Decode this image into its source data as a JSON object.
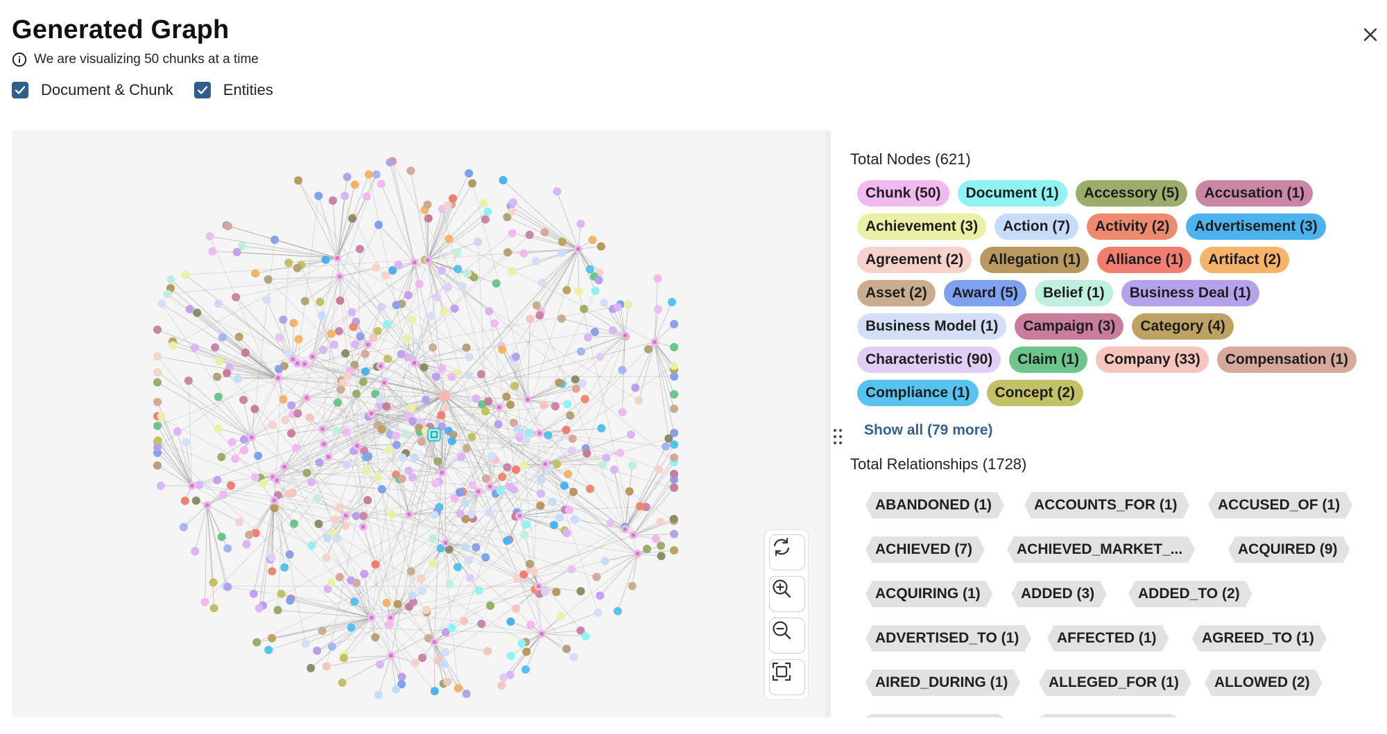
{
  "header": {
    "title": "Generated Graph",
    "info_text": "We are visualizing 50 chunks at a time",
    "checkboxes": [
      {
        "label": "Document & Chunk",
        "checked": true
      },
      {
        "label": "Entities",
        "checked": true
      }
    ]
  },
  "sidebar": {
    "search_placeholder": "",
    "nodes_title": "Total Nodes (621)",
    "node_labels": [
      {
        "label": "Chunk (50)",
        "color": "#f1b9ef"
      },
      {
        "label": "Document (1)",
        "color": "#8ff3f4"
      },
      {
        "label": "Accessory (5)",
        "color": "#9aae6b"
      },
      {
        "label": "Accusation (1)",
        "color": "#c986a6"
      },
      {
        "label": "Achievement (3)",
        "color": "#ebf0a7"
      },
      {
        "label": "Action (7)",
        "color": "#c6dcf8"
      },
      {
        "label": "Activity (2)",
        "color": "#ed8a6f"
      },
      {
        "label": "Advertisement (3)",
        "color": "#4db3ef"
      },
      {
        "label": "Agreement (2)",
        "color": "#f6d2cb"
      },
      {
        "label": "Allegation (1)",
        "color": "#b89a60"
      },
      {
        "label": "Alliance (1)",
        "color": "#f07f72"
      },
      {
        "label": "Artifact (2)",
        "color": "#f5b46a"
      },
      {
        "label": "Asset (2)",
        "color": "#c9ad8e"
      },
      {
        "label": "Award (5)",
        "color": "#7ea1f0"
      },
      {
        "label": "Belief (1)",
        "color": "#bff0dd"
      },
      {
        "label": "Business Deal (1)",
        "color": "#b4a3ec"
      },
      {
        "label": "Business Model (1)",
        "color": "#d3def7"
      },
      {
        "label": "Campaign (3)",
        "color": "#c77d9b"
      },
      {
        "label": "Category (4)",
        "color": "#bea264"
      },
      {
        "label": "Characteristic (90)",
        "color": "#e2cdf7"
      },
      {
        "label": "Claim (1)",
        "color": "#6dc48c"
      },
      {
        "label": "Company (33)",
        "color": "#f6c5bd"
      },
      {
        "label": "Compensation (1)",
        "color": "#d6a99c"
      },
      {
        "label": "Compliance (1)",
        "color": "#55c3ee"
      },
      {
        "label": "Concept (2)",
        "color": "#c2c166"
      }
    ],
    "show_all": "Show all (79 more)",
    "relationships_title": "Total Relationships (1728)",
    "relationship_rows": [
      [
        "ABANDONED (1)",
        "ACCOUNTS_FOR (1)",
        "ACCUSED_OF (1)"
      ],
      [
        "ACHIEVED (7)",
        "ACHIEVED_MARKET_...",
        "ACQUIRED (9)"
      ],
      [
        "ACQUIRING (1)",
        "ADDED (3)",
        "ADDED_TO (2)"
      ],
      [
        "ADVERTISED_TO (1)",
        "AFFECTED (1)",
        "AGREED_TO (1)"
      ],
      [
        "AIRED_DURING (1)",
        "ALLEGED_FOR (1)",
        "ALLOWED (2)"
      ]
    ]
  },
  "graph": {
    "edge_color": "#9a9a9a",
    "hub_color": "#f7b7ad",
    "document_color": "#8ff3f4",
    "chunk_color": "#c97bbf"
  },
  "icons": {
    "close": "close-icon",
    "info": "info-icon",
    "refresh": "refresh-icon",
    "zoom_in": "zoom-in-icon",
    "zoom_out": "zoom-out-icon",
    "fit": "fit-to-screen-icon",
    "search": "search-icon",
    "drag": "drag-handle-icon"
  }
}
